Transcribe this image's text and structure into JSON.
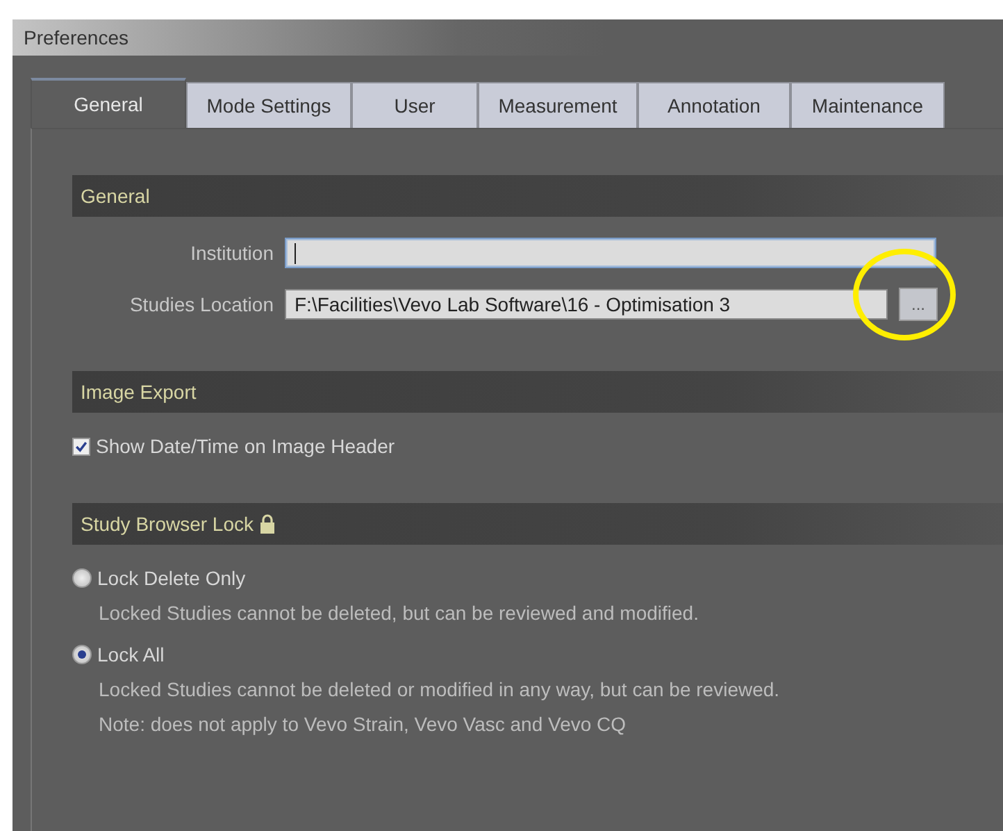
{
  "window": {
    "title": "Preferences"
  },
  "tabs": [
    {
      "label": "General",
      "selected": true
    },
    {
      "label": "Mode Settings",
      "selected": false
    },
    {
      "label": "User",
      "selected": false
    },
    {
      "label": "Measurement",
      "selected": false
    },
    {
      "label": "Annotation",
      "selected": false
    },
    {
      "label": "Maintenance",
      "selected": false
    }
  ],
  "sections": [
    {
      "title": "General",
      "kind": "fields",
      "locked": false,
      "fields": [
        {
          "label": "Institution",
          "focused": true
        },
        {
          "label": "Studies Location",
          "value": "F:\\Facilities\\Vevo Lab Software\\16 - Optimisation 3",
          "focused": false,
          "browse_button": "...",
          "highlighted": true
        }
      ]
    },
    {
      "title": "Image Export",
      "kind": "checkboxes",
      "locked": false,
      "items": [
        {
          "label": "Show Date/Time on Image Header",
          "checked": true
        }
      ]
    },
    {
      "title": "Study Browser Lock",
      "kind": "radios",
      "locked": true,
      "items": [
        {
          "label": "Lock Delete Only",
          "selected": false,
          "notes": [
            "Locked Studies cannot be deleted, but can be reviewed and modified."
          ]
        },
        {
          "label": "Lock All",
          "selected": true,
          "notes": [
            "Locked Studies cannot be deleted or modified in any way, but can be reviewed.",
            "Note: does not apply to Vevo Strain, Vevo Vasc and Vevo CQ"
          ]
        }
      ]
    }
  ]
}
